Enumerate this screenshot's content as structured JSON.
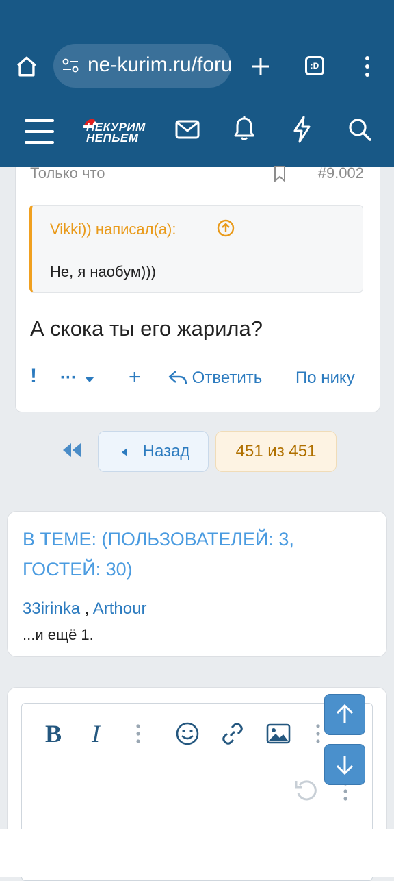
{
  "browser": {
    "url": "ne-kurim.ru/forum",
    "tab_count": ":D"
  },
  "site": {
    "logo_line1": "НЕКУРИМ",
    "logo_line2": "НЕПЬЕМ"
  },
  "post": {
    "time": "Только что",
    "number": "#9.002",
    "quote_author": "Vikki)) написал(а):",
    "quote_text": "Не, я наобум)))",
    "body": "А скока ты его жарила?",
    "actions": {
      "more": "···",
      "reply": "Ответить",
      "by_nick": "По нику"
    }
  },
  "pagination": {
    "back": "Назад",
    "page": "451 из 451"
  },
  "who": {
    "title": "В ТЕМЕ: (ПОЛЬЗОВАТЕЛЕЙ: 3, ГОСТЕЙ: 30)",
    "users": [
      "33irinka",
      "Arthour"
    ],
    "separator": " , ",
    "more": "...и ещё 1."
  },
  "colors": {
    "header": "#185886",
    "link": "#2c7bbf",
    "quote_accent": "#f0a020",
    "page_current_bg": "#fdf3e3"
  }
}
